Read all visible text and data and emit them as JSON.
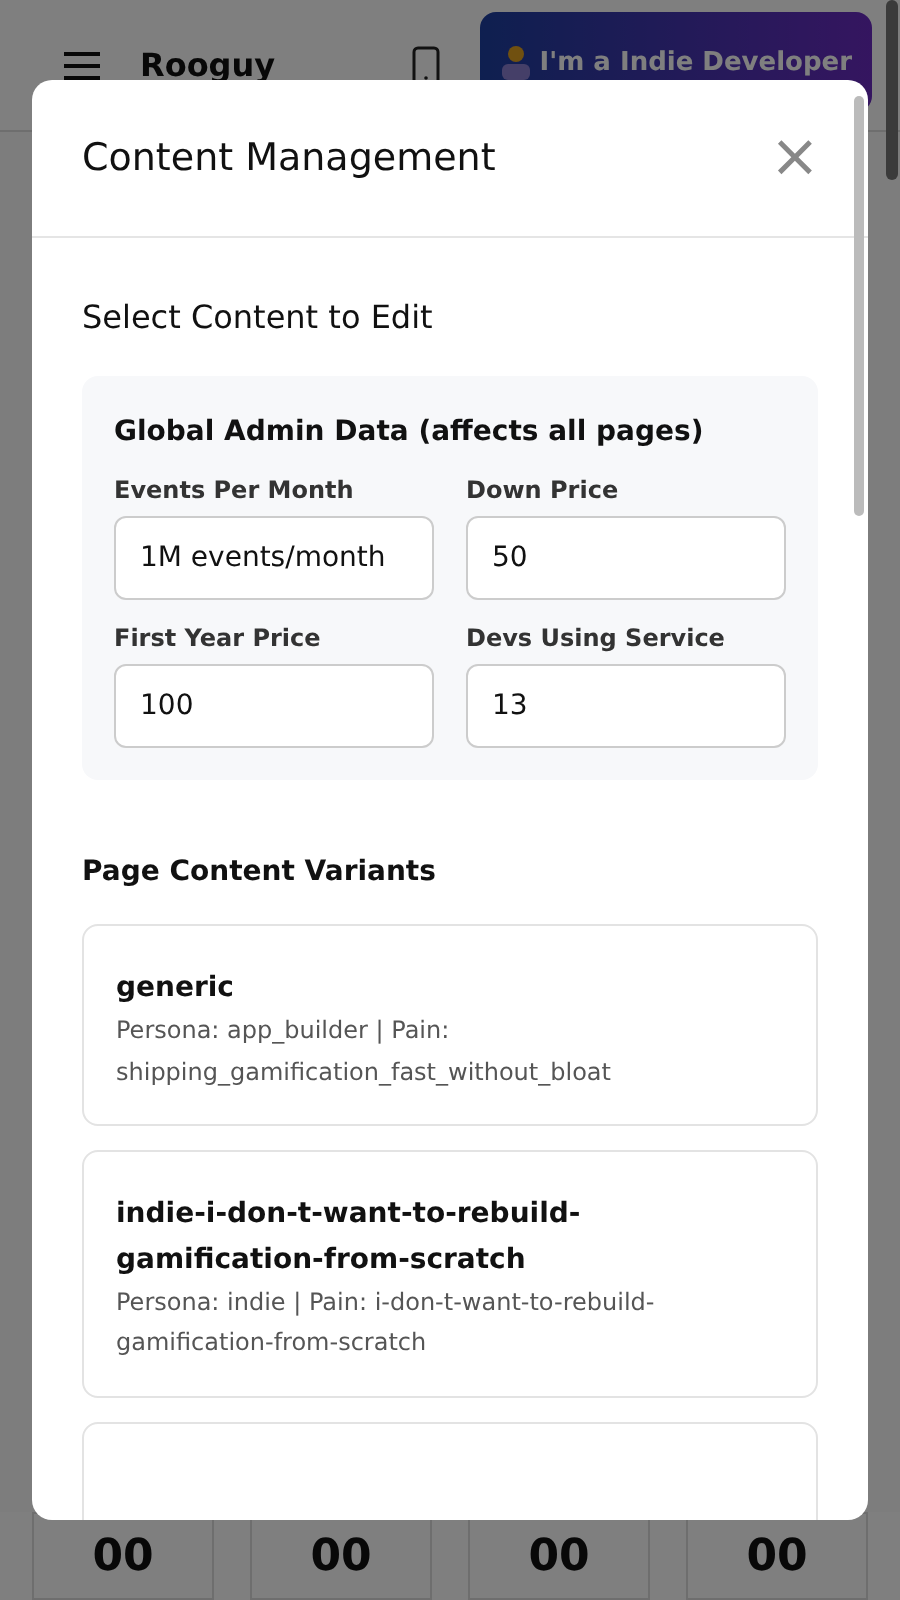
{
  "page": {
    "brand": "Rooguy",
    "persona_button": "I'm a Indie Developer",
    "counters": [
      "00",
      "00",
      "00",
      "00"
    ]
  },
  "modal": {
    "title": "Content Management",
    "close": "×",
    "section_title": "Select Content to Edit",
    "global_panel": {
      "title": "Global Admin Data (affects all pages)",
      "fields": [
        {
          "label": "Events Per Month",
          "value": "1M events/month"
        },
        {
          "label": "Down Price",
          "value": "50"
        },
        {
          "label": "First Year Price",
          "value": "100"
        },
        {
          "label": "Devs Using Service",
          "value": "13"
        }
      ]
    },
    "variants_title": "Page Content Variants",
    "variants": [
      {
        "name": "generic",
        "details": "Persona: app_builder | Pain: shipping_gamification_fast_without_bloat"
      },
      {
        "name": "indie-i-don-t-want-to-rebuild-gamification-from-scratch",
        "details": "Persona: indie | Pain: i-don-t-want-to-rebuild-gamification-from-scratch"
      },
      {
        "kind": "clipped"
      }
    ]
  }
}
